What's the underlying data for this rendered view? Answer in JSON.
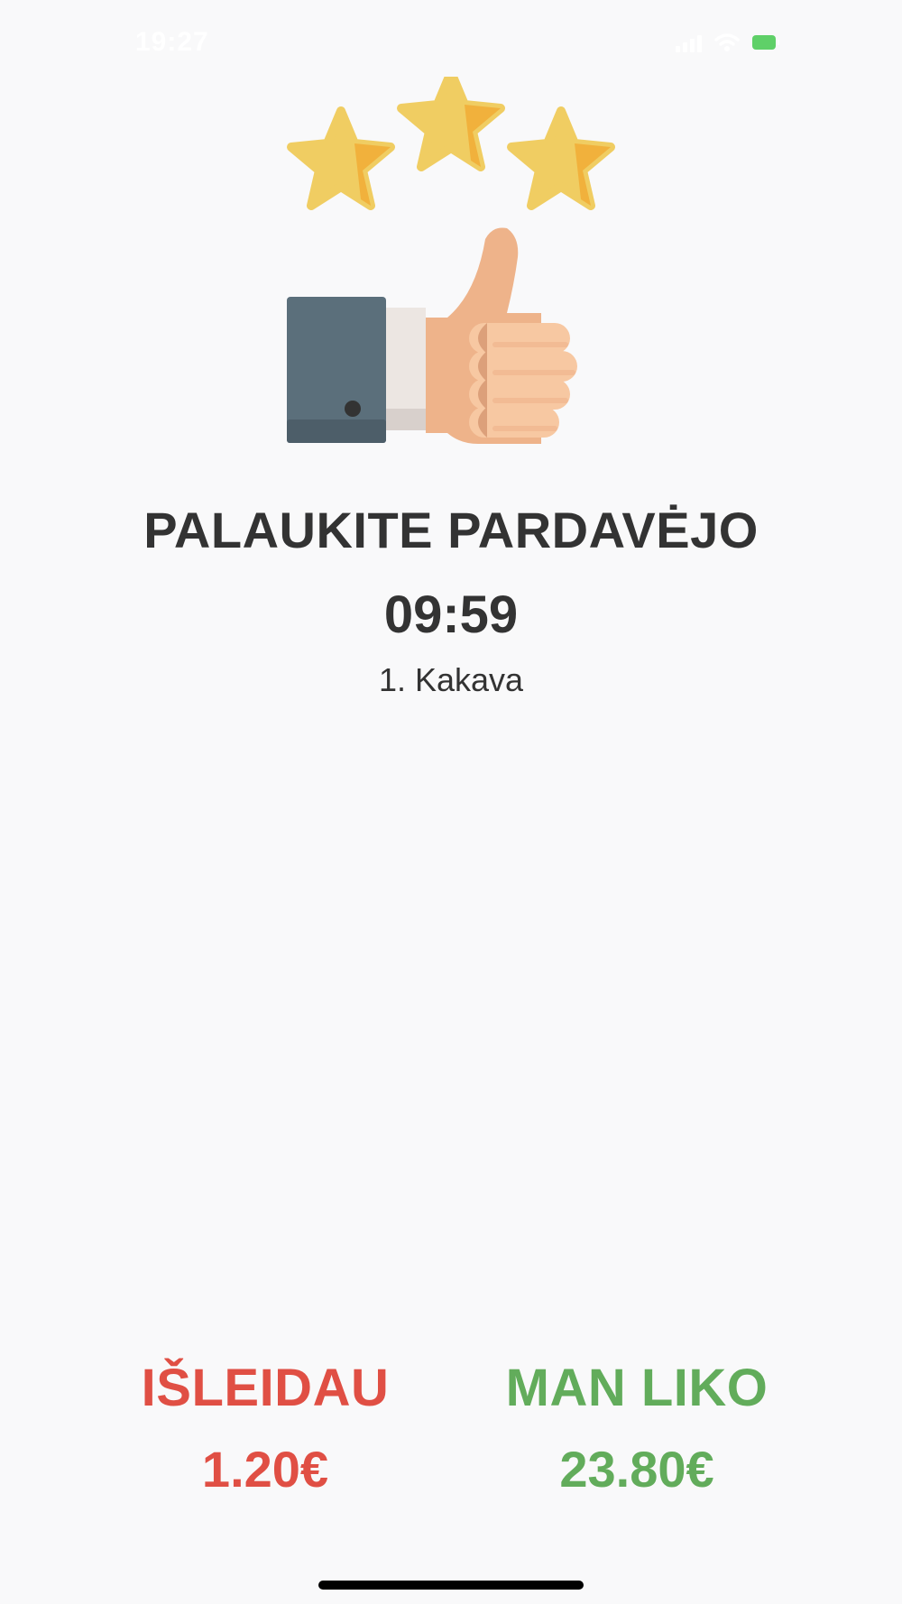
{
  "status_bar": {
    "time": "19:27",
    "signal_icon": "signal-icon",
    "wifi_icon": "wifi-icon",
    "battery_icon": "battery-icon"
  },
  "illustration": {
    "icons": [
      "star-icon",
      "star-icon",
      "star-icon",
      "thumbs-up-icon"
    ]
  },
  "main": {
    "title": "PALAUKITE PARDAVĖJO",
    "timer": "09:59",
    "order_item": "1. Kakava"
  },
  "stats": {
    "spent_label": "IŠLEIDAU",
    "spent_value": "1.20€",
    "left_label": "MAN LIKO",
    "left_value": "23.80€"
  },
  "colors": {
    "background": "#f9f9fa",
    "text": "#333333",
    "spent": "#e04f44",
    "left": "#62ac5b",
    "star": "#f0cd62",
    "star_shade": "#f1b13c"
  }
}
